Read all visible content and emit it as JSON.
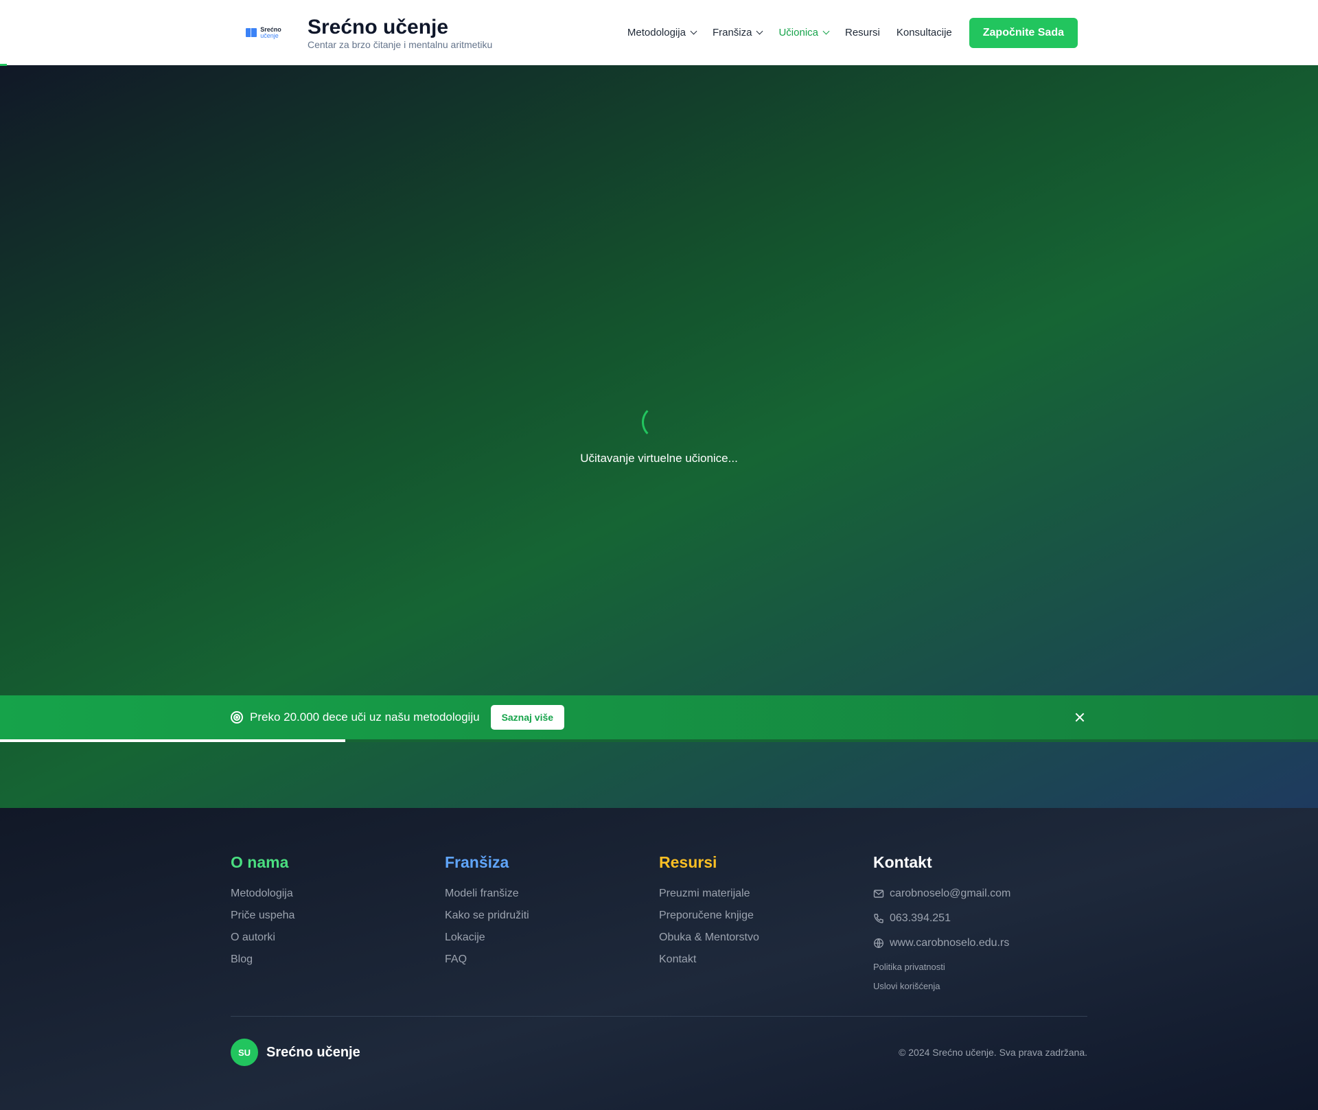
{
  "header": {
    "logo_line1": "Srećno",
    "logo_line2": "učenje",
    "title": "Srećno učenje",
    "subtitle": "Centar za brzo čitanje i mentalnu aritmetiku",
    "nav": [
      {
        "label": "Metodologija"
      },
      {
        "label": "Franšiza"
      },
      {
        "label": "Učionica"
      },
      {
        "label": "Resursi"
      },
      {
        "label": "Konsultacije"
      }
    ],
    "cta_label": "Započnite Sada",
    "active_color": "#16a34a",
    "accent_color": "#22c55e"
  },
  "hero": {
    "loading_text": "Učitavanje virtuelne učionice..."
  },
  "banner": {
    "text": "Preko 20.000 dece uči uz našu metodologiju",
    "button_label": "Saznaj više",
    "progress": 0.262,
    "icon": "target-icon"
  },
  "footer": {
    "columns": [
      {
        "title": "O nama",
        "color": "#4ade80",
        "links": [
          "Metodologija",
          "Priče uspeha",
          "O autorki",
          "Blog"
        ]
      },
      {
        "title": "Franšiza",
        "color": "#60a5fa",
        "links": [
          "Modeli franšize",
          "Kako se pridružiti",
          "Lokacije",
          "FAQ"
        ]
      },
      {
        "title": "Resursi",
        "color": "#fbbf24",
        "links": [
          "Preuzmi materijale",
          "Preporučene knjige",
          "Obuka & Mentorstvo",
          "Kontakt"
        ]
      }
    ],
    "contact": {
      "title": "Kontakt",
      "email": "carobnoselo@gmail.com",
      "phone": "063.394.251",
      "website": "www.carobnoselo.edu.rs",
      "privacy": "Politika privatnosti",
      "terms": "Uslovi korišćenja"
    },
    "badge": "SU",
    "brand": "Srećno učenje",
    "copyright": "© 2024 Srećno učenje. Sva prava zadržana."
  }
}
